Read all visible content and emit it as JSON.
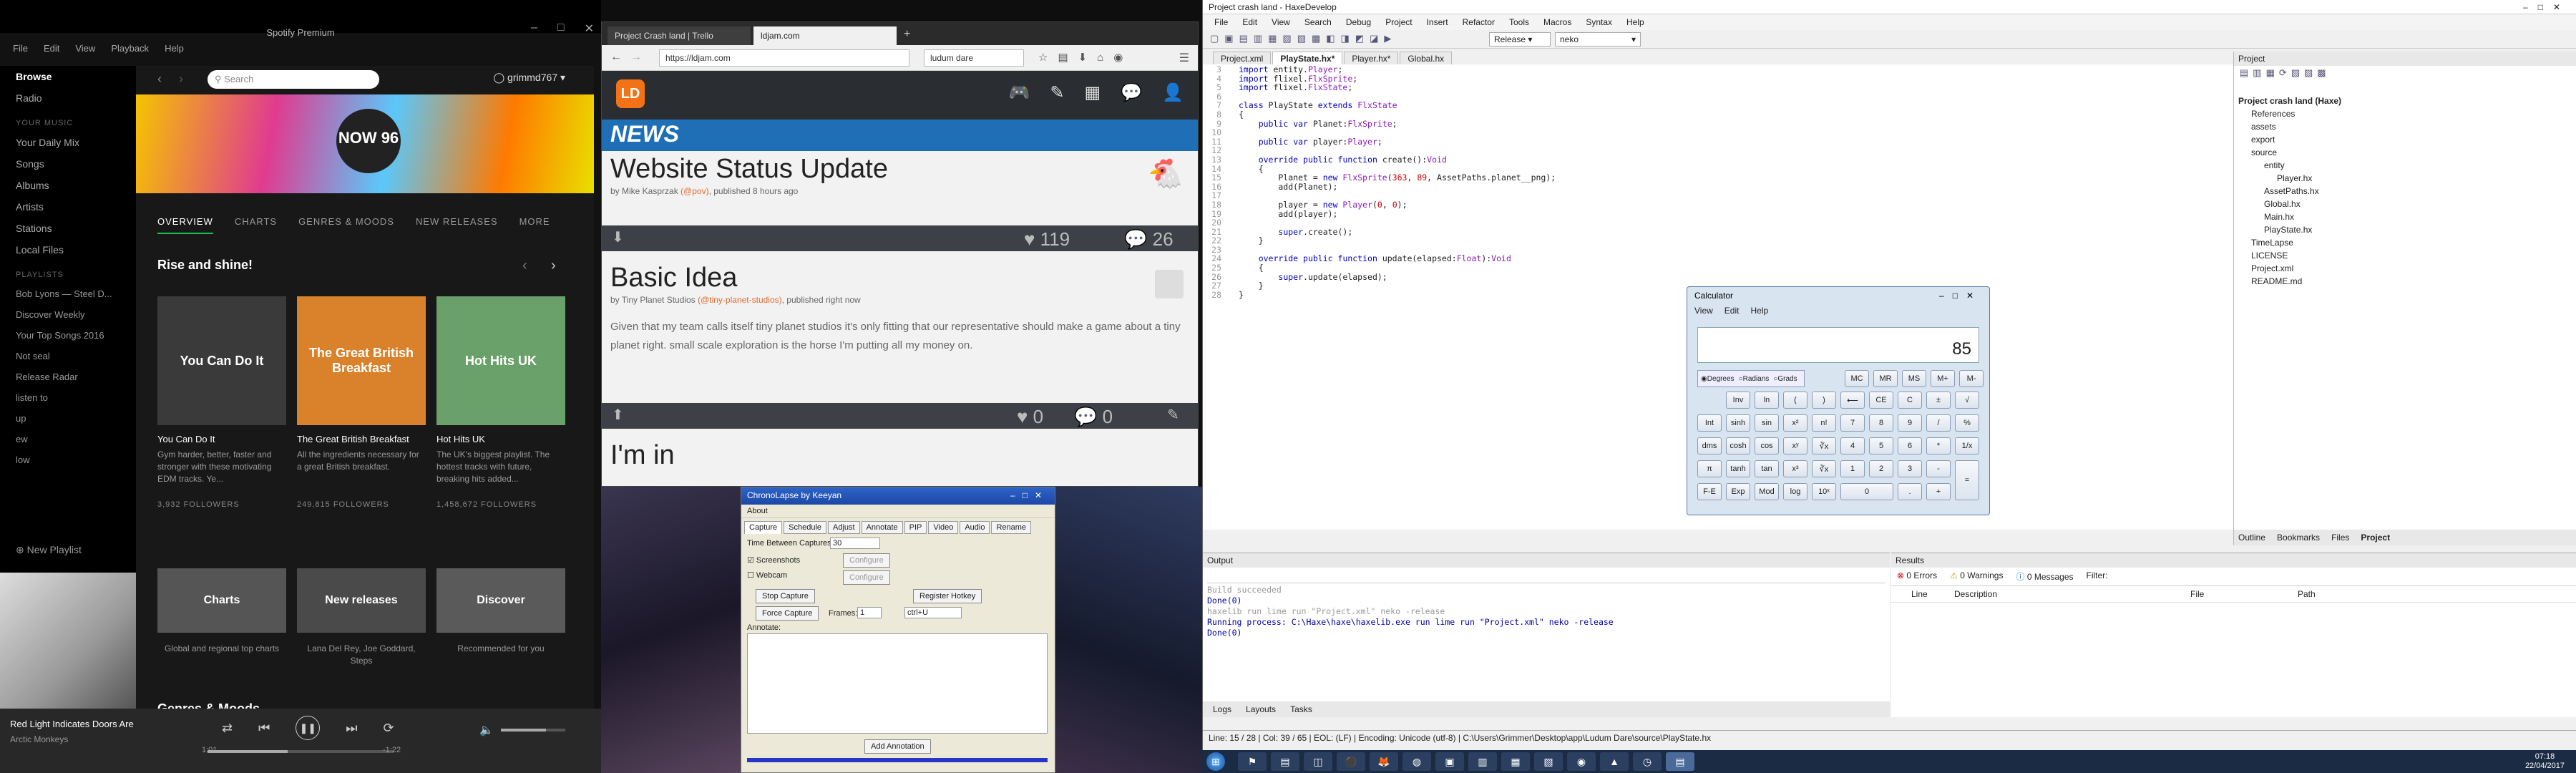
{
  "spotify": {
    "title": "Spotify Premium",
    "menu": [
      "File",
      "Edit",
      "View",
      "Playback",
      "Help"
    ],
    "search_placeholder": "Search",
    "user": "grimmd767",
    "nav": [
      "Browse",
      "Radio"
    ],
    "library_heading": "YOUR MUSIC",
    "library": [
      "Your Daily Mix",
      "Songs",
      "Albums",
      "Artists",
      "Stations",
      "Local Files"
    ],
    "playlists_heading": "PLAYLISTS",
    "playlists": [
      "Bob Lyons — Steel D...",
      "Discover Weekly",
      "Your Top Songs 2016",
      "Not seal",
      "Release Radar",
      "listen to",
      "up",
      "ew",
      "low"
    ],
    "new_playlist": "New Playlist",
    "banner_text": "NOW 96",
    "tabs": [
      "OVERVIEW",
      "CHARTS",
      "GENRES & MOODS",
      "NEW RELEASES",
      "MORE"
    ],
    "section_title": "Rise and shine!",
    "cards": [
      {
        "art": "You Can Do It",
        "name": "You Can Do It",
        "desc": "Gym harder, better, faster and stronger with these motivating EDM tracks. Ye...",
        "followers": "3,932 FOLLOWERS",
        "color": "#3a3a3a"
      },
      {
        "art": "The Great British Breakfast",
        "name": "The Great British Breakfast",
        "desc": "All the ingredients necessary for a great British breakfast.",
        "followers": "249,815 FOLLOWERS",
        "color": "#d9822b"
      },
      {
        "art": "Hot Hits UK",
        "name": "Hot Hits UK",
        "desc": "The UK's biggest playlist. The hottest tracks with future, breaking hits added...",
        "followers": "1,458,672 FOLLOWERS",
        "color": "#6aa06a"
      }
    ],
    "categories": [
      {
        "name": "Charts",
        "desc": "Global and regional top charts"
      },
      {
        "name": "New releases",
        "desc": "Lana Del Rey, Joe Goddard, Steps"
      },
      {
        "name": "Discover",
        "desc": "Recommended for you"
      }
    ],
    "genres_title": "Genres & Moods",
    "now_playing": {
      "song": "Red Light Indicates Doors Are",
      "artist": "Arctic Monkeys",
      "elapsed": "1:01",
      "remaining": "-1:22",
      "progress": 0.43,
      "volume": 0.7
    }
  },
  "browser": {
    "tabs": [
      "Project Crash land | Trello",
      "ldjam.com"
    ],
    "url": "https://ldjam.com",
    "search": "ludum dare",
    "news_label": "NEWS",
    "posts": [
      {
        "title": "Website Status Update",
        "by": "by Mike Kasprzak",
        "handle": "(@pov)",
        "time": ", published 8 hours ago",
        "likes": "119",
        "comments": "26"
      },
      {
        "title": "Basic Idea",
        "by": "by Tiny Planet Studios",
        "handle": "(@tiny-planet-studios)",
        "time": ", published right now",
        "body": "Given that my team calls itself tiny planet studios it's only fitting that our representative should make a game about a tiny planet right. small scale exploration is the horse I'm putting all my money on.",
        "likes": "0",
        "comments": "0"
      },
      {
        "title": "I'm in"
      }
    ]
  },
  "chrono": {
    "title": "ChronoLapse by Keeyan",
    "menu": "About",
    "tabs": [
      "Capture",
      "Schedule",
      "Adjust",
      "Annotate",
      "PIP",
      "Video",
      "Audio",
      "Rename"
    ],
    "between": "Time Between Captures:",
    "between_val": "30",
    "screenshots": "Screenshots",
    "webcam": "Webcam",
    "configure": "Configure",
    "stop": "Stop Capture",
    "force": "Force Capture",
    "frames_label": "Frames:",
    "frames_val": "1",
    "register": "Register Hotkey",
    "hotkey": "ctrl+U",
    "annotate": "Annotate:",
    "add": "Add Annotation"
  },
  "haxe": {
    "title": "Project crash land - HaxeDevelop",
    "menu": [
      "File",
      "Edit",
      "View",
      "Search",
      "Debug",
      "Project",
      "Insert",
      "Refactor",
      "Tools",
      "Macros",
      "Syntax",
      "Help"
    ],
    "config": "Release",
    "target": "neko",
    "editor_tabs": [
      "Project.xml",
      "PlayState.hx*",
      "Player.hx*",
      "Global.hx"
    ],
    "code": [
      [
        "3",
        "import entity.Player;"
      ],
      [
        "4",
        "import flixel.FlxSprite;"
      ],
      [
        "5",
        "import flixel.FlxState;"
      ],
      [
        "6",
        ""
      ],
      [
        "7",
        "class PlayState extends FlxState"
      ],
      [
        "8",
        "{"
      ],
      [
        "9",
        "    public var Planet:FlxSprite;"
      ],
      [
        "10",
        ""
      ],
      [
        "11",
        "    public var player:Player;"
      ],
      [
        "12",
        ""
      ],
      [
        "13",
        "    override public function create():Void"
      ],
      [
        "14",
        "    {"
      ],
      [
        "15",
        "        Planet = new FlxSprite(363, 89, AssetPaths.planet__png);"
      ],
      [
        "16",
        "        add(Planet);"
      ],
      [
        "17",
        ""
      ],
      [
        "18",
        "        player = new Player(0, 0);"
      ],
      [
        "19",
        "        add(player);"
      ],
      [
        "20",
        ""
      ],
      [
        "21",
        "        super.create();"
      ],
      [
        "22",
        "    }"
      ],
      [
        "23",
        ""
      ],
      [
        "24",
        "    override public function update(elapsed:Float):Void"
      ],
      [
        "25",
        "    {"
      ],
      [
        "26",
        "        super.update(elapsed);"
      ],
      [
        "27",
        "    }"
      ],
      [
        "28",
        "}"
      ]
    ],
    "project_header": "Project",
    "tree": [
      "Project crash land (Haxe)",
      "References",
      "assets",
      "export",
      "source",
      "entity",
      "Player.hx",
      "AssetPaths.hx",
      "Global.hx",
      "Main.hx",
      "PlayState.hx",
      "TimeLapse",
      "LICENSE",
      "Project.xml",
      "README.md"
    ],
    "panel_tabs": [
      "Outline",
      "Bookmarks",
      "Files",
      "Project"
    ],
    "output_header": "Output",
    "output": [
      "Build succeeded",
      "Done(0)",
      "haxelib run lime run \"Project.xml\" neko -release",
      "Running process: C:\\Haxe\\haxe\\haxelib.exe run lime run \"Project.xml\" neko -release",
      "Done(0)"
    ],
    "results_header": "Results",
    "results_filters": [
      "0 Errors",
      "0 Warnings",
      "0 Messages",
      "Filter:"
    ],
    "results_cols": [
      "Line",
      "Description",
      "File",
      "Path"
    ],
    "bottom_tabs": [
      "Logs",
      "Layouts",
      "Tasks"
    ],
    "status": "Line: 15 / 28   |   Col: 39 / 65   |   EOL: (LF)   |   Encoding: Unicode (utf-8)   |   C:\\Users\\Grimmer\\Desktop\\app\\Ludum Dare\\source\\PlayState.hx"
  },
  "calc": {
    "title": "Calculator",
    "menu": [
      "View",
      "Edit",
      "Help"
    ],
    "display": "85",
    "modes": [
      "Degrees",
      "Radians",
      "Grads"
    ],
    "rows": [
      [
        "",
        "Inv",
        "ln",
        "(",
        ")",
        "⟵",
        "CE",
        "C",
        "±",
        "√"
      ],
      [
        "Int",
        "sinh",
        "sin",
        "x²",
        "n!",
        "7",
        "8",
        "9",
        "/",
        "%"
      ],
      [
        "dms",
        "cosh",
        "cos",
        "xʸ",
        "∛x",
        "4",
        "5",
        "6",
        "*",
        "1/x"
      ],
      [
        "π",
        "tanh",
        "tan",
        "x³",
        "∛x",
        "1",
        "2",
        "3",
        "-",
        "="
      ],
      [
        "F-E",
        "Exp",
        "Mod",
        "log",
        "10ˣ",
        "0",
        "",
        ".",
        "+",
        ""
      ]
    ],
    "mem": [
      "MC",
      "MR",
      "MS",
      "M+",
      "M-"
    ]
  },
  "taskbar": {
    "time": "07:18",
    "date": "22/04/2017"
  }
}
